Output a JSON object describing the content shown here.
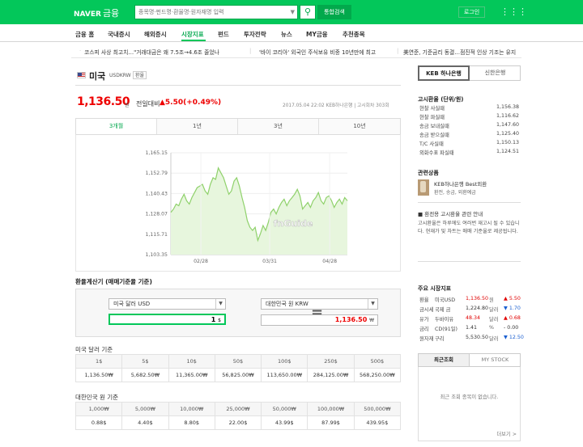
{
  "header": {
    "brand": "NAVER",
    "service": "금융",
    "search_placeholder": "종목명·펀드명·환율명·원자재명 입력",
    "search_dropdown": "▼",
    "search_icon": "search-icon",
    "search_total": "통합검색",
    "login": "로그인",
    "apps_icon": "grid-icon"
  },
  "nav": {
    "items": [
      "금융 홈",
      "국내증시",
      "해외증시",
      "시장지표",
      "펀드",
      "투자전략",
      "뉴스",
      "MY금융",
      "추천종목"
    ],
    "active": "시장지표"
  },
  "ticker": [
    "코스피 사상 최고치…\"거래대금은 왜 7.5조→4.6조 줄었나",
    "'바이 코리아' 외국인 주식보유 비중 10년만에 최고",
    "美연준, 기준금리 동결…점진적 인상 기조는 유지"
  ],
  "currency": {
    "name": "미국",
    "code": "USDKRW",
    "tag": "환율",
    "price": "1,136.50",
    "unit": "원",
    "change_label": "전일대비",
    "change": "▲5.50(+0.49%)",
    "meta": "2017.05.04 22:02 KEB하나은행 | 고시회차 303회"
  },
  "period_tabs": [
    "3개월",
    "1년",
    "3년",
    "10년"
  ],
  "chart_data": {
    "type": "area",
    "x_ticks": [
      "02/28",
      "03/31",
      "04/28"
    ],
    "y_ticks": [
      1165.15,
      1152.79,
      1140.43,
      1128.07,
      1115.71,
      1103.35
    ],
    "ylim": [
      1103.35,
      1165.15
    ],
    "watermark": "fnGuide",
    "values": [
      1129,
      1131,
      1134,
      1133,
      1137,
      1140,
      1136,
      1134,
      1138,
      1141,
      1144,
      1145,
      1146,
      1142,
      1140,
      1146,
      1150,
      1149,
      1156,
      1153,
      1150,
      1145,
      1140,
      1142,
      1148,
      1150,
      1145,
      1138,
      1132,
      1124,
      1120,
      1118,
      1120,
      1112,
      1116,
      1121,
      1118,
      1123,
      1129,
      1131,
      1128,
      1132,
      1135,
      1137,
      1133,
      1136,
      1138,
      1140,
      1143,
      1139,
      1131,
      1133,
      1135,
      1132,
      1136,
      1138,
      1141,
      1136,
      1134,
      1138,
      1139,
      1136,
      1132,
      1135,
      1137,
      1134,
      1138,
      1136
    ]
  },
  "calculator": {
    "title": "환율계산기 (매매기준율 기준)",
    "from_currency": "미국 달러 USD",
    "from_amount": "1",
    "from_unit": "$",
    "to_currency": "대한민국 원 KRW",
    "to_amount": "1,136.50",
    "to_unit": "₩",
    "equals": "="
  },
  "usd_table": {
    "title": "미국 달러 기준",
    "headers": [
      "1$",
      "5$",
      "10$",
      "50$",
      "100$",
      "250$",
      "500$"
    ],
    "values": [
      "1,136.50₩",
      "5,682.50₩",
      "11,365.00₩",
      "56,825.00₩",
      "113,650.00₩",
      "284,125.00₩",
      "568,250.00₩"
    ]
  },
  "krw_table": {
    "title": "대한민국 원 기준",
    "headers": [
      "1,000₩",
      "5,000₩",
      "10,000₩",
      "25,000₩",
      "50,000₩",
      "100,000₩",
      "500,000₩"
    ],
    "values": [
      "0.88$",
      "4.40$",
      "8.80$",
      "22.00$",
      "43.99$",
      "87.99$",
      "439.95$"
    ]
  },
  "bank_tabs": [
    "KEB 하나은행",
    "신한은행"
  ],
  "rates": {
    "title": "고시환율 (단위/원)",
    "rows": [
      {
        "label": "현찰 사실때",
        "value": "1,156.38"
      },
      {
        "label": "현찰 파실때",
        "value": "1,116.62"
      },
      {
        "label": "송금 보내실때",
        "value": "1,147.60"
      },
      {
        "label": "송금 받으실때",
        "value": "1,125.40"
      },
      {
        "label": "T/C 사실때",
        "value": "1,150.13"
      },
      {
        "label": "외화수표 파실때",
        "value": "1,124.51"
      }
    ]
  },
  "related": {
    "title": "관련상품",
    "product": "KEB하나은행 Best외환",
    "desc": "환전, 송금, 외환예금"
  },
  "info": {
    "title": "환전용 고시환율 관련 안내",
    "text": "고시환율은 하루에도 여러번 재고시 될 수 있습니다. 현재가 및 차트는 매매 기준율로 제공됩니다."
  },
  "market": {
    "title": "주요 시장지표",
    "rows": [
      {
        "cat": "환율",
        "name": "미국USD",
        "value": "1,136.50",
        "unit": "원",
        "change": "▲ 5.50",
        "up": true
      },
      {
        "cat": "금시세",
        "name": "국제 금",
        "value": "1,224.80",
        "unit": "달러",
        "change": "▼ 1.70",
        "up": false
      },
      {
        "cat": "유가",
        "name": "두바이유",
        "value": "48.34",
        "unit": "달러",
        "change": "▲ 0.68",
        "up": true
      },
      {
        "cat": "금리",
        "name": "CD(91일)",
        "value": "1.41",
        "unit": "%",
        "change": "- 0.00",
        "up": null
      },
      {
        "cat": "원자재",
        "name": "구리",
        "value": "5,530.50",
        "unit": "달러",
        "change": "▼ 12.50",
        "up": false
      }
    ]
  },
  "recent": {
    "tabs": [
      "최근조회",
      "MY STOCK"
    ],
    "empty": "최근 조회 종목이 없습니다.",
    "more": "더보기 >"
  },
  "colors": {
    "brand": "#03c75a",
    "up": "#e00000",
    "down": "#1a5fd0"
  }
}
